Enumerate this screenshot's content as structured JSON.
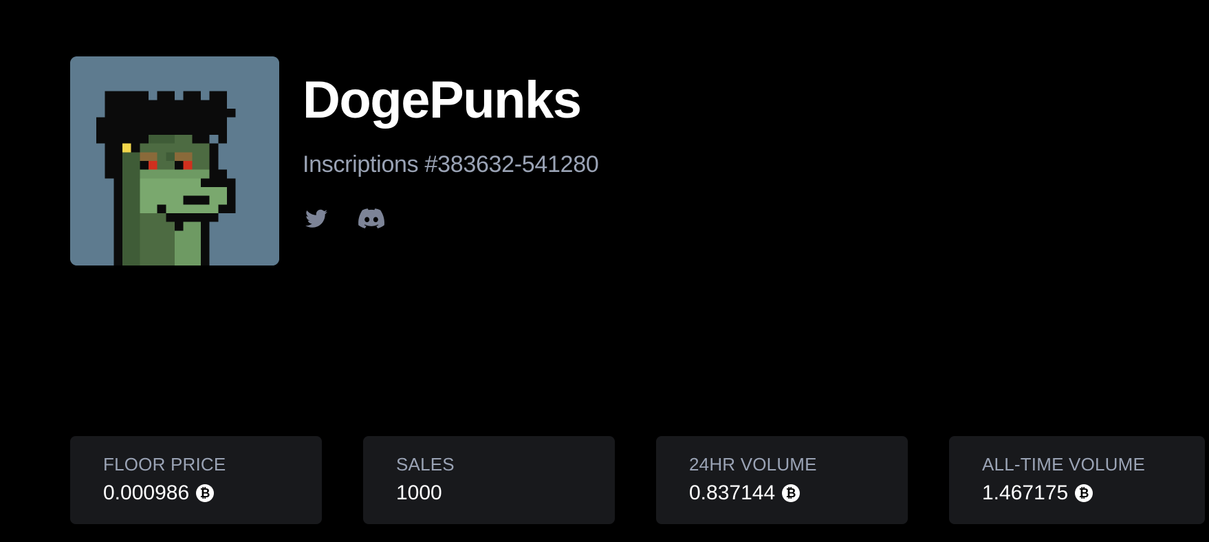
{
  "collection": {
    "name": "DogePunks",
    "inscriptions": "Inscriptions #383632-541280",
    "avatar_icon": "dogepunk-pixel-avatar",
    "socials": [
      {
        "icon": "twitter-icon"
      },
      {
        "icon": "discord-icon"
      }
    ]
  },
  "stats": [
    {
      "label": "FLOOR PRICE",
      "value": "0.000986",
      "currency_icon": "bitcoin-icon",
      "currency_glyph": "₿"
    },
    {
      "label": "SALES",
      "value": "1000"
    },
    {
      "label": "24HR VOLUME",
      "value": "0.837144",
      "currency_icon": "bitcoin-icon",
      "currency_glyph": "₿"
    },
    {
      "label": "ALL-TIME VOLUME",
      "value": "1.467175",
      "currency_icon": "bitcoin-icon",
      "currency_glyph": "₿"
    }
  ],
  "colors": {
    "background": "#000000",
    "card": "#18191c",
    "muted_text": "#9aa3b5",
    "icon": "#7d8497",
    "avatar_bg": "#5e7b8f"
  }
}
